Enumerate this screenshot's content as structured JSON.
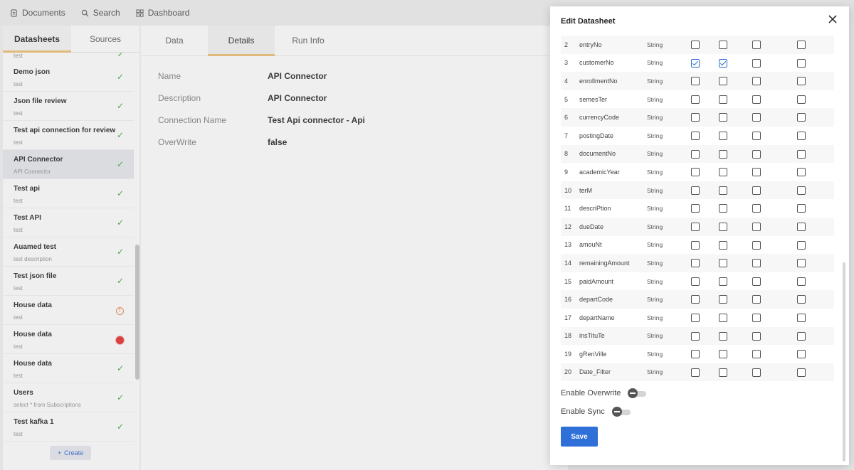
{
  "topnav": {
    "items": [
      {
        "label": "Documents",
        "icon": "document-icon"
      },
      {
        "label": "Search",
        "icon": "search-icon"
      },
      {
        "label": "Dashboard",
        "icon": "dashboard-icon"
      }
    ]
  },
  "left_panel": {
    "tabs": [
      {
        "label": "Datasheets",
        "active": true
      },
      {
        "label": "Sources",
        "active": false
      }
    ],
    "top_stub_desc": "test",
    "items": [
      {
        "name": "Demo json",
        "desc": "test",
        "status": "ok"
      },
      {
        "name": "Json file review",
        "desc": "test",
        "status": "ok"
      },
      {
        "name": "Test api connection for review",
        "desc": "test",
        "status": "ok"
      },
      {
        "name": "API Connector",
        "desc": "API Connector",
        "status": "ok",
        "active": true
      },
      {
        "name": "Test api",
        "desc": "test",
        "status": "ok"
      },
      {
        "name": "Test API",
        "desc": "test",
        "status": "ok"
      },
      {
        "name": "Auamed test",
        "desc": "test description",
        "status": "ok"
      },
      {
        "name": "Test json file",
        "desc": "test",
        "status": "ok"
      },
      {
        "name": "House data",
        "desc": "test",
        "status": "warning"
      },
      {
        "name": "House data",
        "desc": "test",
        "status": "error"
      },
      {
        "name": "House data",
        "desc": "test",
        "status": "ok"
      },
      {
        "name": "Users",
        "desc": "select * from Subscriptions",
        "status": "ok"
      },
      {
        "name": "Test kafka 1",
        "desc": "test",
        "status": "ok"
      }
    ],
    "create_label": "Create",
    "status_colors": {
      "ok": "#4caf50",
      "warning": "#e98b55",
      "error": "#e53935"
    }
  },
  "main": {
    "tabs": [
      {
        "label": "Data",
        "active": false
      },
      {
        "label": "Details",
        "active": true
      },
      {
        "label": "Run Info",
        "active": false
      }
    ],
    "details": [
      {
        "label": "Name",
        "value": "API Connector"
      },
      {
        "label": "Description",
        "value": "API Connector"
      },
      {
        "label": "Connection Name",
        "value": "Test Api connector - Api"
      },
      {
        "label": "OverWrite",
        "value": "false"
      }
    ]
  },
  "modal": {
    "title": "Edit Datasheet",
    "rows": [
      {
        "num": "2",
        "name": "entryNo",
        "type": "String",
        "checks": [
          false,
          false,
          false,
          false
        ]
      },
      {
        "num": "3",
        "name": "customerNo",
        "type": "String",
        "checks": [
          true,
          true,
          false,
          false
        ]
      },
      {
        "num": "4",
        "name": "enrollmentNo",
        "type": "String",
        "checks": [
          false,
          false,
          false,
          false
        ]
      },
      {
        "num": "5",
        "name": "semesTer",
        "type": "String",
        "checks": [
          false,
          false,
          false,
          false
        ]
      },
      {
        "num": "6",
        "name": "currencyCode",
        "type": "String",
        "checks": [
          false,
          false,
          false,
          false
        ]
      },
      {
        "num": "7",
        "name": "postingDate",
        "type": "String",
        "checks": [
          false,
          false,
          false,
          false
        ]
      },
      {
        "num": "8",
        "name": "documentNo",
        "type": "String",
        "checks": [
          false,
          false,
          false,
          false
        ]
      },
      {
        "num": "9",
        "name": "academicYear",
        "type": "String",
        "checks": [
          false,
          false,
          false,
          false
        ]
      },
      {
        "num": "10",
        "name": "terM",
        "type": "String",
        "checks": [
          false,
          false,
          false,
          false
        ]
      },
      {
        "num": "11",
        "name": "descriPtion",
        "type": "String",
        "checks": [
          false,
          false,
          false,
          false
        ]
      },
      {
        "num": "12",
        "name": "dueDate",
        "type": "String",
        "checks": [
          false,
          false,
          false,
          false
        ]
      },
      {
        "num": "13",
        "name": "amouNt",
        "type": "String",
        "checks": [
          false,
          false,
          false,
          false
        ]
      },
      {
        "num": "14",
        "name": "remainingAmount",
        "type": "String",
        "checks": [
          false,
          false,
          false,
          false
        ]
      },
      {
        "num": "15",
        "name": "paidAmount",
        "type": "String",
        "checks": [
          false,
          false,
          false,
          false
        ]
      },
      {
        "num": "16",
        "name": "departCode",
        "type": "String",
        "checks": [
          false,
          false,
          false,
          false
        ]
      },
      {
        "num": "17",
        "name": "departName",
        "type": "String",
        "checks": [
          false,
          false,
          false,
          false
        ]
      },
      {
        "num": "18",
        "name": "insTituTe",
        "type": "String",
        "checks": [
          false,
          false,
          false,
          false
        ]
      },
      {
        "num": "19",
        "name": "gRenVille",
        "type": "String",
        "checks": [
          false,
          false,
          false,
          false
        ]
      },
      {
        "num": "20",
        "name": "Date_Filter",
        "type": "String",
        "checks": [
          false,
          false,
          false,
          false
        ]
      }
    ],
    "enable_overwrite_label": "Enable Overwrite",
    "enable_overwrite_value": false,
    "enable_sync_label": "Enable Sync",
    "enable_sync_value": false,
    "save_label": "Save",
    "accent_color": "#2f6fd8"
  }
}
